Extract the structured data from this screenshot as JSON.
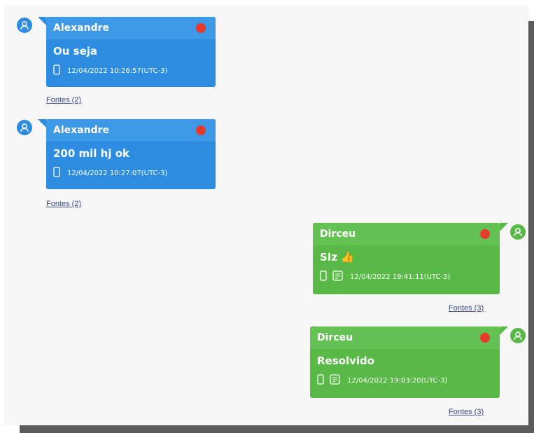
{
  "colors": {
    "sender_blue": "#2d8ce0",
    "sender_green": "#58b947",
    "status_dot": "#e53a2c",
    "link": "#3b4c8a"
  },
  "messages": [
    {
      "sender": "Alexandre",
      "text": "Ou seja",
      "timestamp": "12/04/2022 10:26:57(UTC-3)",
      "sources_link": "Fontes (2)",
      "icons": [
        "phone-icon"
      ]
    },
    {
      "sender": "Alexandre",
      "text": "200 mil hj ok",
      "timestamp": "12/04/2022 10:27:07(UTC-3)",
      "sources_link": "Fontes (2)",
      "icons": [
        "phone-icon"
      ]
    },
    {
      "sender": "Dirceu",
      "text": "SIz 👍",
      "timestamp": "12/04/2022 19:41:11(UTC-3)",
      "sources_link": "Fontes (3)",
      "icons": [
        "phone-icon",
        "database-icon"
      ]
    },
    {
      "sender": "Dirceu",
      "text": "Resolvido",
      "timestamp": "12/04/2022 19:03:20(UTC-3)",
      "sources_link": "Fontes (3)",
      "icons": [
        "phone-icon",
        "database-icon"
      ]
    }
  ]
}
